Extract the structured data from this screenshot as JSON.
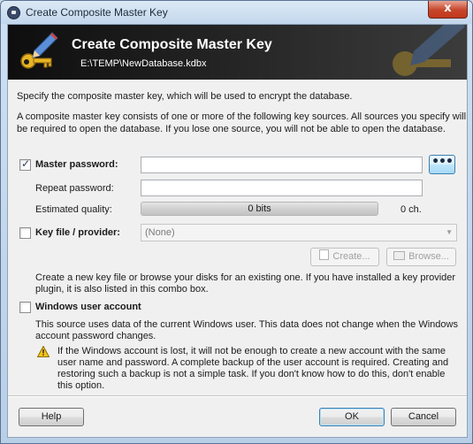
{
  "window": {
    "title": "Create Composite Master Key",
    "close_glyph": "x"
  },
  "banner": {
    "title": "Create Composite Master Key",
    "subtitle": "E:\\TEMP\\NewDatabase.kdbx",
    "icon": "key-pencil-icon"
  },
  "intro": {
    "line1": "Specify the composite master key, which will be used to encrypt the database.",
    "line2a": "A composite master key consists of one or more of the following key sources. All sources you specify will",
    "line2b": "be required to open the database.  If you lose one source, you will not be able to open the database."
  },
  "master_password": {
    "label": "Master password:",
    "checked": true,
    "value": "",
    "repeat_label": "Repeat password:",
    "repeat_value": "",
    "quality_label": "Estimated quality:",
    "quality_value": "0 bits",
    "quality_fraction": 0,
    "char_count": "0 ch.",
    "reveal_button": "•••"
  },
  "key_file": {
    "label": "Key file / provider:",
    "checked": false,
    "selected": "(None)",
    "create_button": "Create...",
    "browse_button": "Browse...",
    "help1": "Create a new key file or browse your disks for an existing one. If you have installed a key provider",
    "help2": "plugin, it is also listed in this combo box."
  },
  "windows_account": {
    "label": "Windows user account",
    "checked": false,
    "desc1": "This source uses data of the current Windows user. This data does not change when the Windows",
    "desc2": "account password changes.",
    "warn1": "If the Windows account is lost, it will not be enough to create a new account with the same",
    "warn2": "user name and password. A complete backup of the user account is required. Creating and",
    "warn3": "restoring such a backup is not a simple task.  If you don't know how to do this, don't enable",
    "warn4": "this option."
  },
  "footer": {
    "help_button": "Help",
    "ok_button": "OK",
    "cancel_button": "Cancel"
  }
}
